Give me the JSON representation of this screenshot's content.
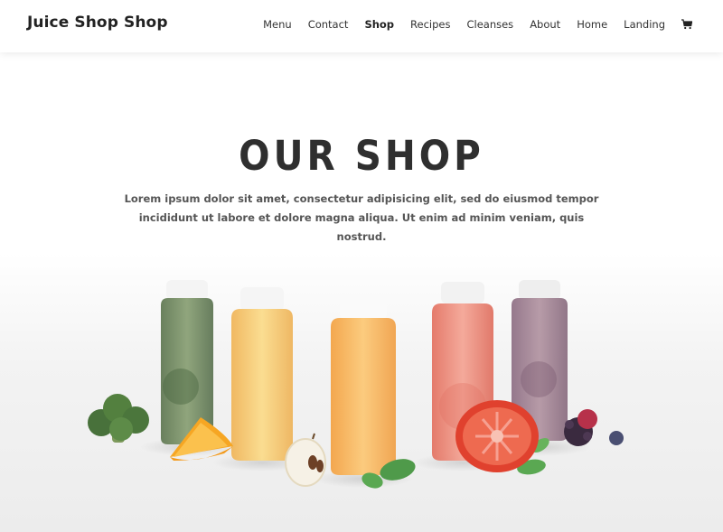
{
  "site": {
    "logo": "Juice Shop Shop"
  },
  "nav": {
    "items": [
      {
        "label": "Menu"
      },
      {
        "label": "Contact"
      },
      {
        "label": "Shop"
      },
      {
        "label": "Recipes"
      },
      {
        "label": "Cleanses"
      },
      {
        "label": "About"
      },
      {
        "label": "Home"
      },
      {
        "label": "Landing"
      }
    ],
    "active": "Shop",
    "cart_icon": "cart-icon"
  },
  "hero": {
    "title": "OUR SHOP",
    "subtitle": "Lorem ipsum dolor sit amet, consectetur adipisicing elit, sed do eiusmod tempor incididunt ut labore et dolore magna aliqua. Ut enim ad minim veniam, quis nostrud."
  },
  "colors": {
    "bottle_green": "#6f8a5f",
    "bottle_yellow": "#f5c76a",
    "bottle_orange": "#f6b45a",
    "bottle_pink": "#ec8a79",
    "bottle_purple": "#9a7a8f",
    "cap": "#f7f7f7"
  }
}
